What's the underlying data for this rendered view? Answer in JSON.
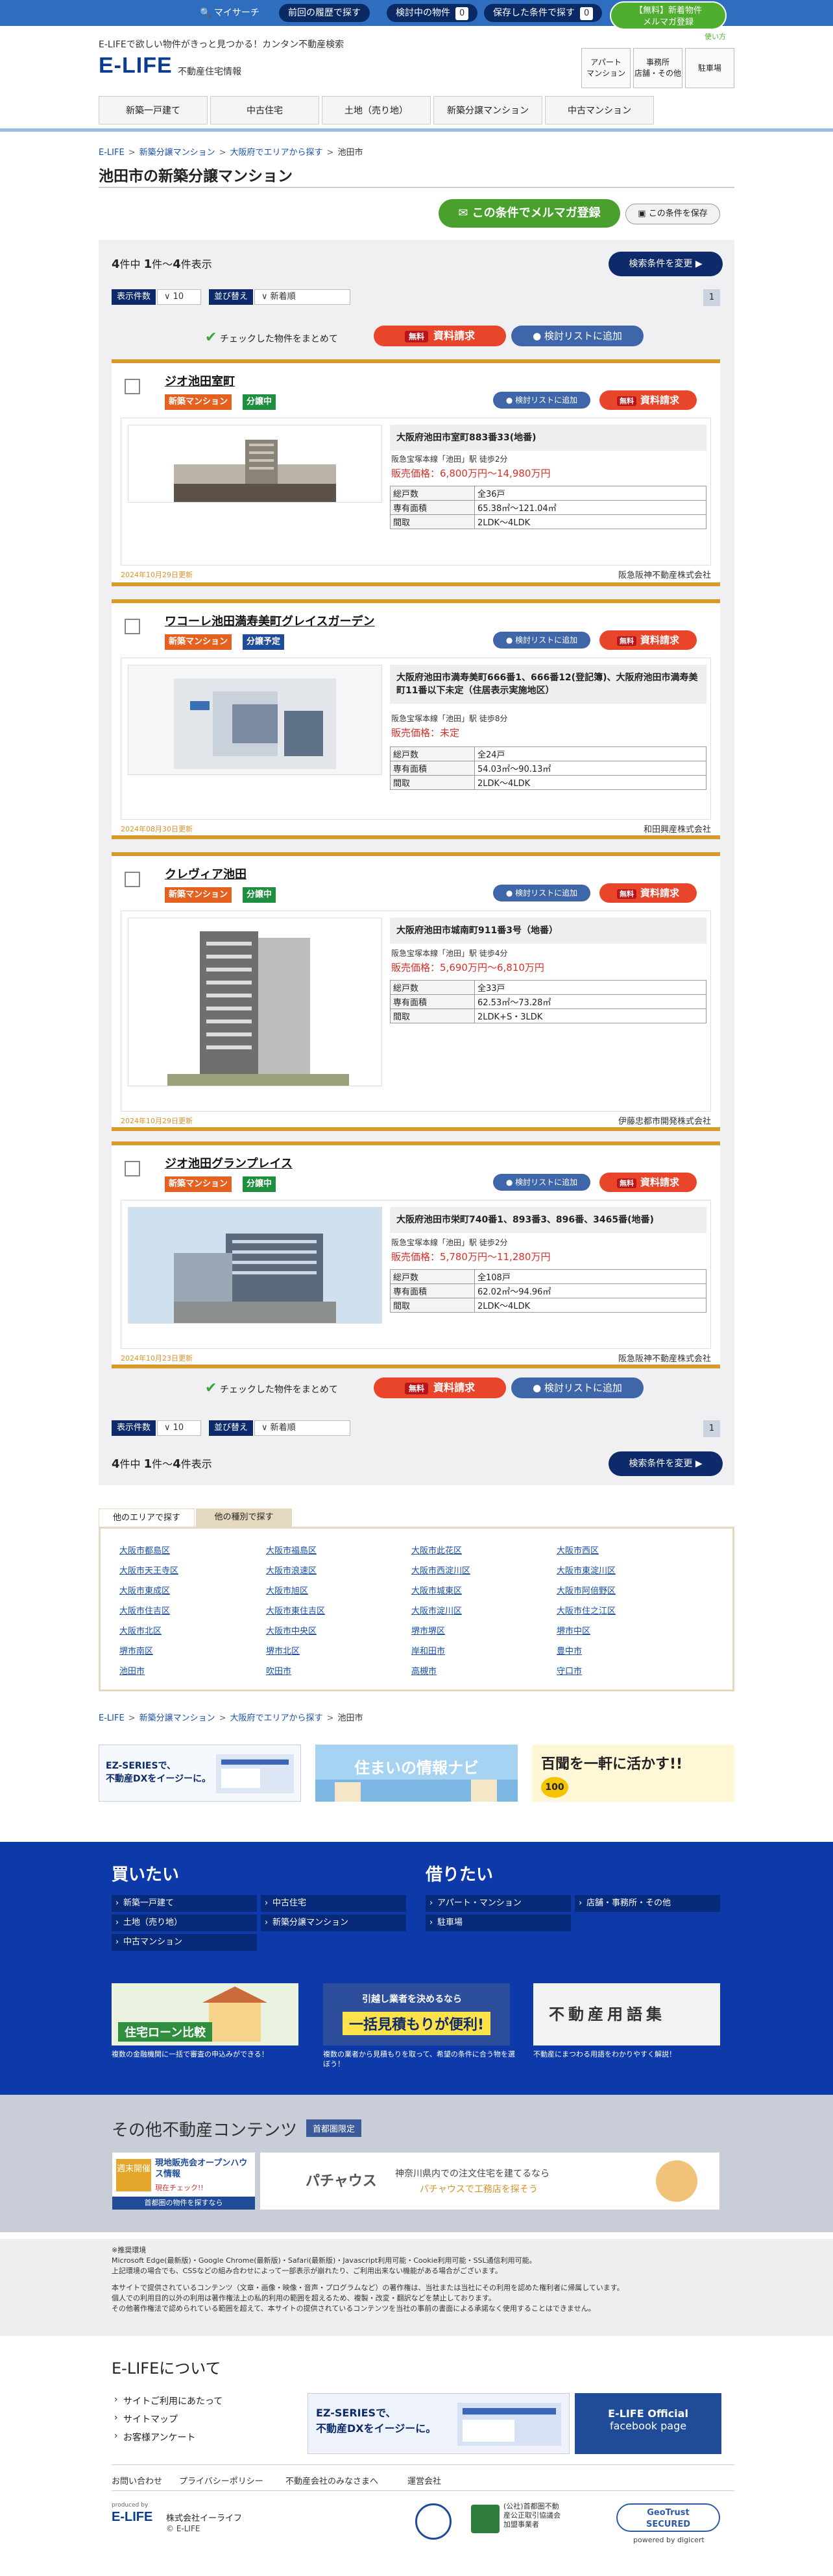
{
  "topbar": {
    "mysearch": "マイサーチ",
    "history": "前回の履歴で探す",
    "considering": "検討中の物件",
    "considering_count": "0",
    "saved": "保存した条件で探す",
    "saved_count": "0",
    "magazine_free": "【無料】",
    "magazine_line1": "新着物件",
    "magazine_line2": "メルマガ登録",
    "guide": "使い方"
  },
  "header": {
    "tagline": "E-LIFEで欲しい物件がきっと見つかる！カンタン不動産検索",
    "logo": "E-LIFE",
    "logo_sub": "不動産住宅情報",
    "nav": [
      {
        "l1": "アパート",
        "l2": "マンション"
      },
      {
        "l1": "事務所",
        "l2": "店舗・その他"
      },
      {
        "l1": "駐車場",
        "l2": ""
      }
    ],
    "tabs": [
      "新築一戸建て",
      "中古住宅",
      "土地（売り地）",
      "新築分譲マンション",
      "中古マンション"
    ]
  },
  "breadcrumb": {
    "items": [
      "E-LIFE",
      "新築分譲マンション",
      "大阪府でエリアから探す"
    ],
    "current": "池田市"
  },
  "page": {
    "title": "池田市の新築分譲マンション",
    "mail_btn": "この条件でメルマガ登録",
    "save_btn": "この条件を保存"
  },
  "results": {
    "total": "4",
    "total_unit": "件中",
    "from": "1",
    "from_unit": "件～",
    "to": "4",
    "to_unit": "件表示",
    "change_btn": "検索条件を変更",
    "per_page_label": "表示件数",
    "per_page_value": "10",
    "sort_label": "並び替え",
    "sort_value": "新着順",
    "page_num": "1",
    "check_all": "チェックした物件をまとめて",
    "free": "無料",
    "request": "資料請求",
    "add_list": "検討リストに追加",
    "small_add_list": "検討リストに追加"
  },
  "labels": {
    "units": "総戸数",
    "area": "専有面積",
    "layout": "間取",
    "price_prefix": "販売価格："
  },
  "properties": [
    {
      "name": "ジオ池田室町",
      "badges": [
        {
          "t": "新築マンション",
          "c": "new"
        },
        {
          "t": "分譲中",
          "c": "sale"
        }
      ],
      "address": "大阪府池田市室町883番33(地番)",
      "station": "阪急宝塚本線「池田」駅 徒歩2分",
      "price": "6,800万円～14,980万円",
      "units": "全36戸",
      "area": "65.38㎡～121.04㎡",
      "layout": "2LDK～4LDK",
      "updated": "2024年10月29日更新",
      "company": "阪急阪神不動産株式会社"
    },
    {
      "name": "ワコーレ池田満寿美町グレイスガーデン",
      "badges": [
        {
          "t": "新築マンション",
          "c": "new"
        },
        {
          "t": "分譲予定",
          "c": "plan"
        }
      ],
      "address": "大阪府池田市満寿美町666番1、666番12(登記簿)、大阪府池田市満寿美町11番以下未定（住居表示実施地区）",
      "station": "阪急宝塚本線「池田」駅 徒歩8分",
      "price": "未定",
      "units": "全24戸",
      "area": "54.03㎡～90.13㎡",
      "layout": "2LDK～4LDK",
      "updated": "2024年08月30日更新",
      "company": "和田興産株式会社"
    },
    {
      "name": "クレヴィア池田",
      "badges": [
        {
          "t": "新築マンション",
          "c": "new"
        },
        {
          "t": "分譲中",
          "c": "sale"
        }
      ],
      "address": "大阪府池田市城南町911番3号（地番）",
      "station": "阪急宝塚本線「池田」駅 徒歩4分",
      "price": "5,690万円～6,810万円",
      "units": "全33戸",
      "area": "62.53㎡～73.28㎡",
      "layout": "2LDK+S・3LDK",
      "updated": "2024年10月29日更新",
      "company": "伊藤忠都市開発株式会社"
    },
    {
      "name": "ジオ池田グランプレイス",
      "badges": [
        {
          "t": "新築マンション",
          "c": "new"
        },
        {
          "t": "分譲中",
          "c": "sale"
        }
      ],
      "address": "大阪府池田市栄町740番1、893番3、896番、3465番(地番)",
      "station": "阪急宝塚本線「池田」駅 徒歩2分",
      "price": "5,780万円～11,280万円",
      "units": "全108戸",
      "area": "62.02㎡～94.96㎡",
      "layout": "2LDK～4LDK",
      "updated": "2024年10月23日更新",
      "company": "阪急阪神不動産株式会社"
    }
  ],
  "area_tabs": [
    "他のエリアで探す",
    "他の種別で探す"
  ],
  "areas": [
    "大阪市都島区",
    "大阪市福島区",
    "大阪市此花区",
    "大阪市西区",
    "大阪市天王寺区",
    "大阪市浪速区",
    "大阪市西淀川区",
    "大阪市東淀川区",
    "大阪市東成区",
    "大阪市旭区",
    "大阪市城東区",
    "大阪市阿倍野区",
    "大阪市住吉区",
    "大阪市東住吉区",
    "大阪市淀川区",
    "大阪市住之江区",
    "大阪市北区",
    "大阪市中央区",
    "堺市堺区",
    "堺市中区",
    "堺市南区",
    "堺市北区",
    "岸和田市",
    "豊中市",
    "池田市",
    "吹田市",
    "高槻市",
    "守口市"
  ],
  "banners": [
    {
      "l1": "EZ-SERIESで、",
      "l2": "不動産DXをイージーに。",
      "bg": "#f5f8fc"
    },
    {
      "l1": "住まいの情報ナビ",
      "l2": "",
      "bg": "#a6d3f2"
    },
    {
      "l1": "百聞を一軒に活かす!!",
      "l2": "",
      "bg": "#fff7d6"
    }
  ],
  "footer": {
    "buy_title": "買いたい",
    "buy_links": [
      "新築一戸建て",
      "中古住宅",
      "土地（売り地）",
      "新築分譲マンション",
      "中古マンション"
    ],
    "rent_title": "借りたい",
    "rent_links": [
      "アパート・マンション",
      "店舗・事務所・その他",
      "駐車場"
    ],
    "promo": [
      {
        "title": "住宅ローン比較",
        "cap": "複数の金融機関に一括で審査の申込みができる！"
      },
      {
        "title": "一括見積もりが便利!",
        "sub": "引越し業者を決めるなら",
        "cap": "複数の業者から見積もりを取って、希望の条件に合う物を選ぼう！"
      },
      {
        "title": "不動産用語集",
        "cap": "不動産にまつわる用語をわかりやすく解説！"
      }
    ],
    "other_title": "その他不動産コンテンツ",
    "other_tag": "首都圏限定",
    "open_house": "現地販売会オープンハウス情報",
    "open_house_sub": "週末開催",
    "open_house_note": "現在チェック!!",
    "open_house_foot": "首都圏の物件を探すなら",
    "pachaus_logo": "パチャウス",
    "pachaus_text1": "神奈川県内での注文住宅を建てるなら",
    "pachaus_text2": "パチャウスで工務店を探そう",
    "disclaimer": [
      "※推奨環境",
      "Microsoft Edge(最新版)・Google Chrome(最新版)・Safari(最新版)・Javascript利用可能・Cookie利用可能・SSL通信利用可能。",
      "上記環境の場合でも、CSSなどの組み合わせによって一部表示が崩れたり、ご利用出来ない機能がある場合がございます。",
      "本サイトで提供されているコンテンツ（文章・画像・映像・音声・プログラムなど）の著作権は、当社または当社にその利用を認めた権利者に帰属しています。",
      "個人での利用目的以外の利用は著作権法上の私的利用の範囲を超えるため、複製・改変・翻訳などを禁止しております。",
      "その他著作権法で認められている範囲を超えて、本サイトの提供されているコンテンツを当社の事前の書面による承諾なく使用することはできません。"
    ],
    "about_title": "E-LIFEについて",
    "about_links": [
      "サイトご利用にあたって",
      "サイトマップ",
      "お客様アンケート"
    ],
    "ez_banner_l1": "EZ-SERIESで、",
    "ez_banner_l2": "不動産DXをイージーに。",
    "fb_l1": "E-LIFE Official",
    "fb_l2": "facebook page",
    "bottom_links": [
      "お問い合わせ",
      "プライバシーポリシー",
      "不動産会社のみなさまへ",
      "運営会社"
    ],
    "produced": "produced by",
    "company": "株式会社イーライフ",
    "copyright": "© E-LIFE",
    "member": "(公社)首都圏不動産公正取引協議会加盟事業者",
    "secured_l1": "GeoTrust",
    "secured_l2": "SECURED",
    "secured_foot": "powered by digicert"
  }
}
